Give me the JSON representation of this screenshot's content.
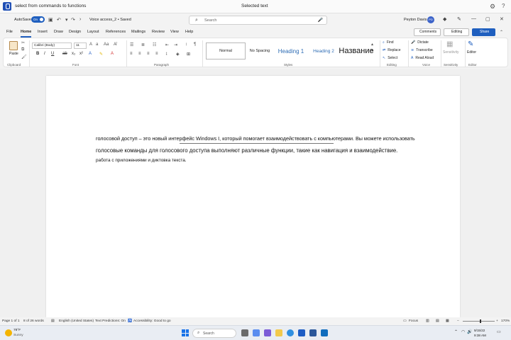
{
  "voice_bar": {
    "command": "select from commands to functions",
    "status": "Selected text"
  },
  "title_bar": {
    "autosave_label": "AutoSave",
    "autosave_state": "On",
    "document_name": "Voice access_2 • Saved",
    "search_placeholder": "Search",
    "user_name": "Peyton Davis",
    "user_initials": "PD"
  },
  "menu": {
    "tabs": [
      "File",
      "Home",
      "Insert",
      "Draw",
      "Design",
      "Layout",
      "References",
      "Mailings",
      "Review",
      "View",
      "Help"
    ],
    "active_tab": "Home",
    "comments_label": "Comments",
    "editing_label": "Editing",
    "share_label": "Share"
  },
  "ribbon": {
    "paste_label": "Paste",
    "font_name": "Calibri (Body)",
    "font_size": "11",
    "styles": [
      "Normal",
      "No Spacing",
      "Heading 1",
      "Heading 2",
      "Название"
    ],
    "find_label": "Find",
    "replace_label": "Replace",
    "select_label": "Select",
    "dictate_label": "Dictate",
    "transcribe_label": "Transcribe",
    "read_aloud_label": "Read Aloud",
    "sensitivity_label": "Sensitivity",
    "editor_label": "Editor",
    "groups": {
      "clipboard": "Clipboard",
      "font": "Font",
      "paragraph": "Paragraph",
      "styles": "Styles",
      "editing": "Editing",
      "voice": "Voice",
      "sensitivity": "Sensitivity",
      "editor": "Editor"
    }
  },
  "document": {
    "line1": "голосовой доступ – это новый интерфейс Windows I, который помогает взаимодействовать с компьютерами. Вы можете использовать",
    "line2": "голосовые команды для голосового доступа выполняют различные функции, такие как навигация и взаимодействие.",
    "line3": "работа с приложениями и диктовка текста."
  },
  "status_bar": {
    "page": "Page 1 of 1",
    "words": "8 of 26 words",
    "language": "English (United States)",
    "text_predictions": "Text Predictions: On",
    "accessibility": "Accessibility: Good to go",
    "focus": "Focus",
    "zoom": "170%"
  },
  "taskbar": {
    "temperature": "78°F",
    "weather": "Sunny",
    "search_placeholder": "Search",
    "time": "9/15/22",
    "date": "9:38 AM"
  },
  "colors": {
    "accent": "#1f5fbf",
    "heading": "#2f6db5"
  }
}
